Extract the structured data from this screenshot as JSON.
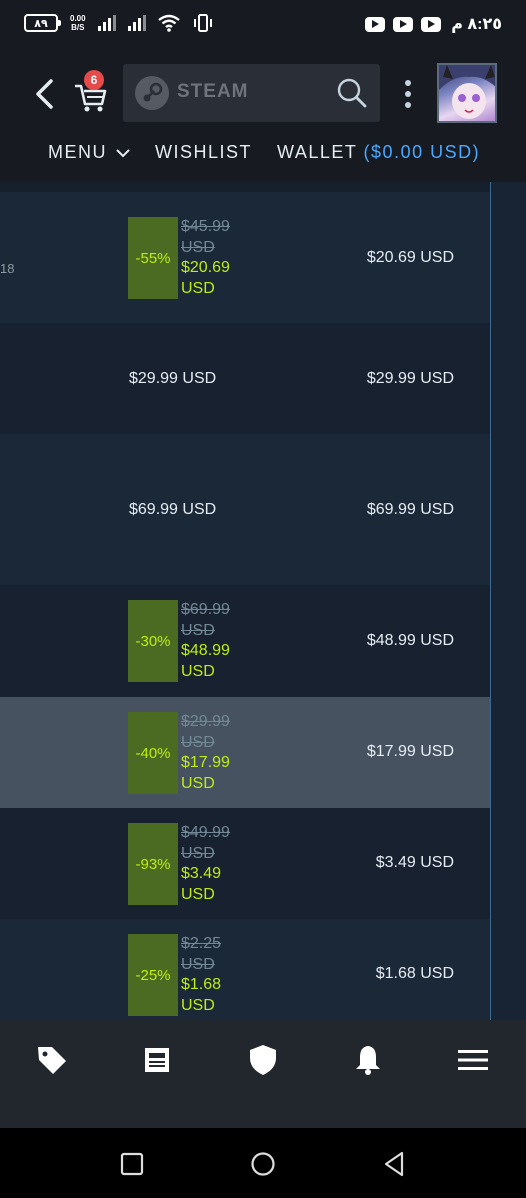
{
  "status_bar": {
    "battery": "٨٩",
    "net_speed_top": "0.00",
    "net_speed_unit": "B/S",
    "time": "٨:٢٥ م"
  },
  "header": {
    "cart_count": "6",
    "search_brand": "STEAM",
    "nav": {
      "menu_label": "MENU",
      "wishlist_label": "WISHLIST",
      "wallet_label": "WALLET",
      "wallet_balance": "($0.00 USD)"
    }
  },
  "rows": [
    {
      "left_fragment": "18",
      "discount": "-55%",
      "original_price": "$45.99",
      "original_currency": "USD",
      "final_price": "$20.69",
      "final_currency": "USD",
      "subtotal": "$20.69 USD"
    },
    {
      "price": "$29.99 USD",
      "subtotal": "$29.99 USD"
    },
    {
      "price": "$69.99 USD",
      "subtotal": "$69.99 USD"
    },
    {
      "discount": "-30%",
      "original_price": "$69.99",
      "original_currency": "USD",
      "final_price": "$48.99",
      "final_currency": "USD",
      "subtotal": "$48.99 USD"
    },
    {
      "discount": "-40%",
      "original_price": "$29.99",
      "original_currency": "USD",
      "final_price": "$17.99",
      "final_currency": "USD",
      "subtotal": "$17.99 USD"
    },
    {
      "discount": "-93%",
      "original_price": "$49.99",
      "original_currency": "USD",
      "final_price": "$3.49",
      "final_currency": "USD",
      "subtotal": "$3.49 USD"
    },
    {
      "discount": "-25%",
      "original_price": "$2.25",
      "original_currency": "USD",
      "final_price": "$1.68",
      "final_currency": "USD",
      "subtotal": "$1.68 USD"
    }
  ],
  "bottom_nav": [
    "tag-icon",
    "news-icon",
    "shield-icon",
    "bell-icon",
    "menu-icon"
  ],
  "colors": {
    "discount_bg": "#4c6b22",
    "discount_text": "#beee11",
    "wallet_accent": "#4aa8ff",
    "badge": "#e54b4b"
  }
}
